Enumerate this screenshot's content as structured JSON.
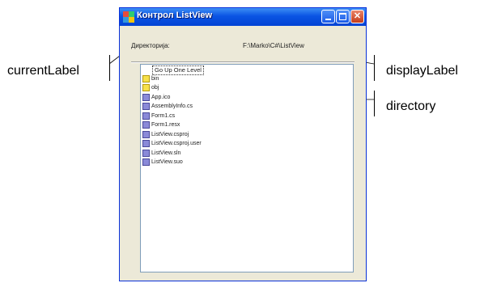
{
  "window": {
    "title": "Контрол ListView",
    "current_label": "Директорија:",
    "display_label": "F:\\Marko\\C#\\ListView"
  },
  "listview": {
    "go_up": "Go Up One Level",
    "items": [
      {
        "label": "bin",
        "kind": "folder"
      },
      {
        "label": "obj",
        "kind": "folder"
      },
      {
        "label": "App.ico",
        "kind": "file"
      },
      {
        "label": "AssemblyInfo.cs",
        "kind": "file"
      },
      {
        "label": "Form1.cs",
        "kind": "file"
      },
      {
        "label": "Form1.resx",
        "kind": "file"
      },
      {
        "label": "ListView.csproj",
        "kind": "file"
      },
      {
        "label": "ListView.csproj.user",
        "kind": "file"
      },
      {
        "label": "ListView.sln",
        "kind": "file"
      },
      {
        "label": "ListView.suo",
        "kind": "file"
      }
    ]
  },
  "annotations": {
    "current_label": "currentLabel",
    "display_label": "displayLabel",
    "directory": "directory"
  },
  "colors": {
    "titlebar": "#0a54e3",
    "folder": "#f7e14a",
    "file": "#8a8ad8",
    "close": "#c43d1a"
  }
}
